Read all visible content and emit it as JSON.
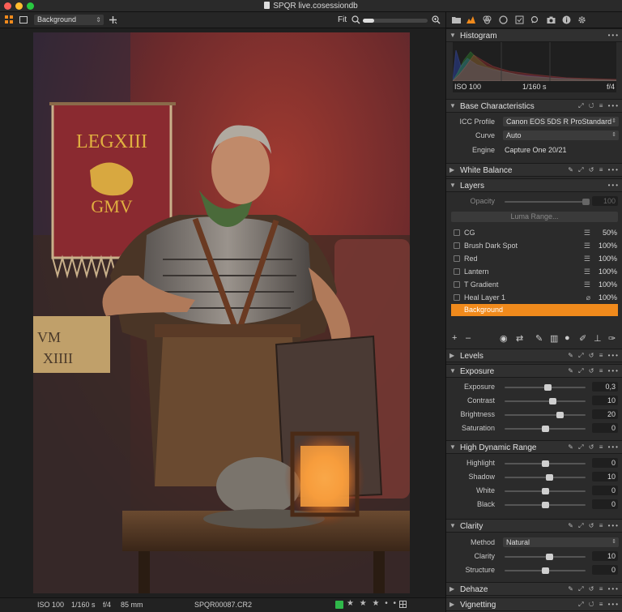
{
  "window": {
    "title": "SPQR live.cosessiondb",
    "colors": {
      "close": "#fe5f57",
      "minimize": "#febc2e",
      "zoom": "#28c840",
      "accent": "#f08a1c",
      "color_tag": "#2fb84a"
    }
  },
  "toolbar": {
    "layer_select": "Background",
    "fit_label": "Fit",
    "zoom_level": 0.18
  },
  "status": {
    "iso": "ISO 100",
    "shutter": "1/160 s",
    "aperture": "f/4",
    "focal": "85 mm",
    "filename": "SPQR00087.CR2",
    "stars": "★ ★ ★ • •"
  },
  "tabs": [
    "folder-icon",
    "adjust-icon",
    "color-icon",
    "lens-icon",
    "checklist-icon",
    "search-icon",
    "camera-icon",
    "info-icon",
    "gear-icon"
  ],
  "histogram": {
    "title": "Histogram",
    "iso": "ISO 100",
    "shutter": "1/160 s",
    "aperture": "f/4"
  },
  "base": {
    "title": "Base Characteristics",
    "icc_label": "ICC Profile",
    "icc_value": "Canon EOS 5DS R ProStandard",
    "curve_label": "Curve",
    "curve_value": "Auto",
    "engine_label": "Engine",
    "engine_value": "Capture One 20/21"
  },
  "white_balance": {
    "title": "White Balance"
  },
  "layers": {
    "title": "Layers",
    "opacity_label": "Opacity",
    "opacity_value": "100",
    "luma_button": "Luma Range...",
    "items": [
      {
        "name": "CG",
        "opacity": "50%"
      },
      {
        "name": "Brush Dark Spot",
        "opacity": "100%"
      },
      {
        "name": "Red",
        "opacity": "100%"
      },
      {
        "name": "Lantern",
        "opacity": "100%"
      },
      {
        "name": "T Gradient",
        "opacity": "100%"
      },
      {
        "name": "Heal Layer 1",
        "opacity": "100%"
      },
      {
        "name": "Background",
        "opacity": ""
      }
    ]
  },
  "levels": {
    "title": "Levels"
  },
  "exposure": {
    "title": "Exposure",
    "rows": [
      {
        "label": "Exposure",
        "value": "0,3",
        "pos": 0.53
      },
      {
        "label": "Contrast",
        "value": "10",
        "pos": 0.59
      },
      {
        "label": "Brightness",
        "value": "20",
        "pos": 0.68
      },
      {
        "label": "Saturation",
        "value": "0",
        "pos": 0.5
      }
    ]
  },
  "hdr": {
    "title": "High Dynamic Range",
    "rows": [
      {
        "label": "Highlight",
        "value": "0",
        "pos": 0.5
      },
      {
        "label": "Shadow",
        "value": "10",
        "pos": 0.55
      },
      {
        "label": "White",
        "value": "0",
        "pos": 0.5
      },
      {
        "label": "Black",
        "value": "0",
        "pos": 0.5
      }
    ]
  },
  "clarity": {
    "title": "Clarity",
    "method_label": "Method",
    "method_value": "Natural",
    "rows": [
      {
        "label": "Clarity",
        "value": "10",
        "pos": 0.55
      },
      {
        "label": "Structure",
        "value": "0",
        "pos": 0.5
      }
    ]
  },
  "dehaze": {
    "title": "Dehaze"
  },
  "vignetting": {
    "title": "Vignetting"
  }
}
